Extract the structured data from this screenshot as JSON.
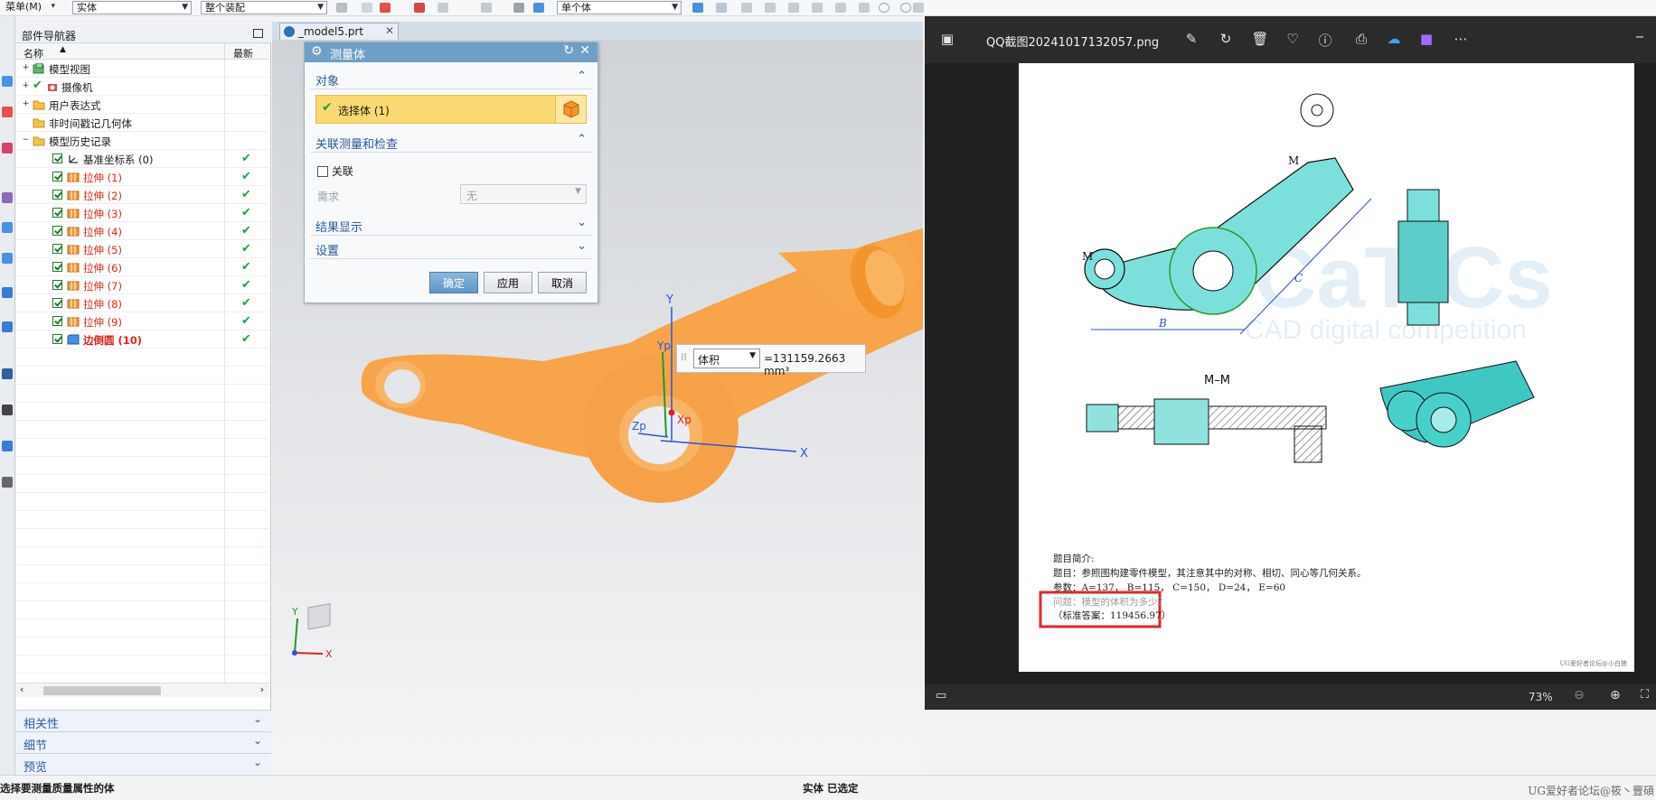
{
  "toolbar": {
    "menu_label": "菜单(M)",
    "filter_type": "实体",
    "scope": "整个装配",
    "body_scope": "单个体"
  },
  "navigator": {
    "title": "部件导航器",
    "col_name": "名称",
    "col_latest": "最新",
    "items": [
      {
        "label": "模型视图"
      },
      {
        "label": "摄像机"
      },
      {
        "label": "用户表达式"
      },
      {
        "label": "非时间戳记几何体"
      },
      {
        "label": "模型历史记录"
      },
      {
        "label": "基准坐标系 (0)"
      },
      {
        "label": "拉伸 (1)"
      },
      {
        "label": "拉伸 (2)"
      },
      {
        "label": "拉伸 (3)"
      },
      {
        "label": "拉伸 (4)"
      },
      {
        "label": "拉伸 (5)"
      },
      {
        "label": "拉伸 (6)"
      },
      {
        "label": "拉伸 (7)"
      },
      {
        "label": "拉伸 (8)"
      },
      {
        "label": "拉伸 (9)"
      },
      {
        "label": "边倒圆 (10)"
      }
    ],
    "panels": [
      "相关性",
      "细节",
      "预览"
    ]
  },
  "tab": {
    "label": "_model5.prt"
  },
  "dialog": {
    "title": "测量体",
    "section_object": "对象",
    "select_body": "选择体 (1)",
    "section_assoc": "关联测量和检查",
    "assoc_label": "关联",
    "require_label": "需求",
    "require_value": "无",
    "section_results": "结果显示",
    "section_settings": "设置",
    "ok": "确定",
    "apply": "应用",
    "cancel": "取消"
  },
  "readout": {
    "type": "体积",
    "value": "=131159.2663 mm³"
  },
  "axes": {
    "y": "Y",
    "yp": "Yp",
    "zp": "Zp",
    "xp": "Xp",
    "x": "X",
    "tri_y": "Y",
    "tri_x": "X"
  },
  "viewer": {
    "filename": "QQ截图20241017132057.png",
    "zoom": "73%"
  },
  "drawing": {
    "section_label": "M–M",
    "watermark_1": "CaTICs",
    "watermark_2": "CAD digital competition",
    "note_title": "题目简介:",
    "note_line1": "题目：参照图构建零件模型，其注意其中的对称、相切、同心等几何关系。",
    "note_line2": "参数：A=137，  B=115，  C=150，  D=24，  E=60",
    "note_line3": "问题：模型的体积为多少？",
    "answer": "（标准答案：119456.97）",
    "footer_tag": "UG爱好者论坛@小白狼"
  },
  "status": {
    "left": "选择要测量质量属性的体",
    "center": "实体 已选定",
    "right": "UG爱好者论坛@筱丶豐碩"
  },
  "colors": {
    "part": "#f7a44a",
    "highlight": "#fbd972",
    "accent": "#6e9fc6",
    "answer_box": "#e5262a"
  }
}
